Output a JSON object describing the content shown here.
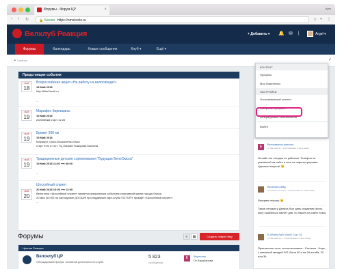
{
  "browser": {
    "tab_title": "Форумы - Форум ЦР",
    "user": "Ilyan",
    "secure_label": "Secure",
    "url": "https://omskvelo.ru",
    "back_icon": "arrow-left-icon",
    "forward_icon": "arrow-right-icon",
    "reload_icon": "reload-icon"
  },
  "header": {
    "logo_text": "Велклуб Реакция",
    "add_label": "+ Добавить ▾",
    "user_label": "Argel ▾"
  },
  "nav": {
    "items": [
      "Форумы",
      "Календарь",
      "Новые сообщения",
      "Клуб ▾",
      "Ещё ▾"
    ]
  },
  "breadcrumb": "⚑ Главная",
  "events": {
    "title": "Предстоящие события",
    "items": [
      {
        "month": "МАЙ",
        "day": "18",
        "title": "Всероссийская акция «На работу на велосипеде!»",
        "date": "18 Май 2018",
        "line2": "http://bike2work.ru",
        "line3": "..."
      },
      {
        "month": "МАЙ",
        "day": "19",
        "title": "Марафон Кирпицаны",
        "date": "19 Май 2018",
        "line2": "20/40/60км старт 12:20",
        "line3": ""
      },
      {
        "month": "МАЙ",
        "day": "19",
        "title": "Бревет 200 км",
        "date": "19 Май 2018",
        "line2": "Маршрут: Омск-Москаленки-Омск",
        "line3": "старт 9:00 от ост. ТЦ Омский Пожарная Каланча"
      },
      {
        "month": "МАЙ",
        "day": "19",
        "title": "Традиционные детские соревнования \"Будущая ВелоОмска\"",
        "date": "19 Май 2018 11:00 ⟶ 00:00",
        "line2": "...",
        "line3": ""
      },
      {
        "month": "МАЙ",
        "day": "20",
        "title": "Шоссейный спринт",
        "date": "20 Май 2018 10:00 ⟶ 13:00",
        "line2": "Велогонка «Шоссейный спринт» является уникальным событием спортивной жизни города Омска.",
        "line3": "20 мая (10:00) на картодроме ДОСААФ при поддержке карт-клуба VICTORY пройдёт «Шоссейный спринт».",
        "line4": "..."
      }
    ]
  },
  "forums": {
    "title": "Форумы",
    "create_label": "Создать новую тему",
    "category": "Ценная Реакция",
    "forum_name": "Велоклуб ЦР",
    "forum_desc": "Обсуждаемый форум, основной деятельности клуба",
    "count": "5 823",
    "count_label": "сообщения",
    "last_title": "Форестер",
    "last_by": "От Вакабанова",
    "last_avatar": "E"
  },
  "dropdown": {
    "section1": "КОНТЕНТ",
    "items1": [
      "Профиль",
      "Мои Изменения"
    ],
    "section2": "НАСТРОЙКИ",
    "items2": [
      "Отслеживаемый контент",
      "Настройки профиля",
      "Игнорируемые пользователи"
    ],
    "logout": "Выйти"
  },
  "sidebar": {
    "messages": [
      {
        "name": "Веломаньяк фантом",
        "meta": "От Евгений М · Опубликовано 2 часа назад",
        "text": "Онлайн чат сегодня не работает. Телефон не указанный на сайте в сети не зарегистрирован. Удачных покупок! 😉",
        "avatar": "E",
        "avatar_color": "#b5386d"
      },
      {
        "name": "Веселый рейд",
        "meta": "От Ксения Ольгина · Опубликовано 2 часа назад",
        "text": "Разорвю интригу 😉",
        "avatar": "",
        "avatar_color": "#8b6a4a"
      },
      {
        "name": "",
        "meta": "",
        "text": "Также сегодня у Дениса был день рождения (если, могу ошибаться насчёт дня, но нашёл на сайте пока)",
        "avatar": "",
        "avatar_color": "#ffffff"
      },
      {
        "name": "Б-Works Epic World Cup '14",
        "meta": "От Евгений Кол · Опубликовано 2 часа назад",
        "text": "Практически стои, за исключением - Система - Норе, с овальной звездой 34Т, была 50 и на 34 изгиба, 32 или 36.",
        "avatar": "",
        "avatar_color": "#8b6a4a"
      }
    ]
  },
  "colors": {
    "brand_red": "#d8232a",
    "navy": "#142b4a",
    "highlight": "#e0207f"
  }
}
